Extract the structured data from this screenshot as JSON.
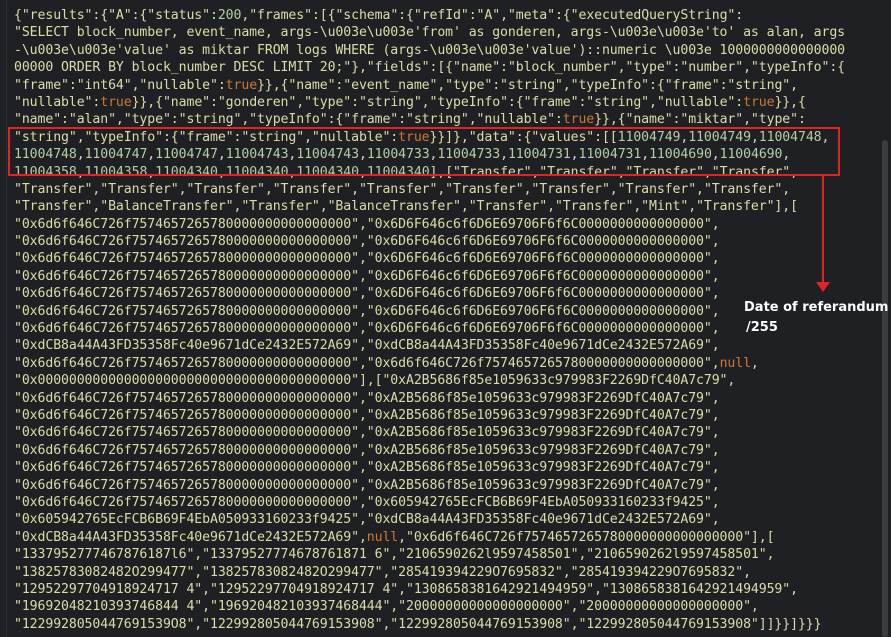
{
  "lines": [
    [
      [
        "{\"results\":{\"A\":{\"status\":",
        "s"
      ],
      [
        "200",
        "n"
      ],
      [
        ",\"frames\":[{\"schema\":{\"refId\":\"A\",\"meta\":{\"executedQueryString\":",
        "s"
      ]
    ],
    [
      [
        "\"SELECT block_number, event_name, args-\\u003e\\u003e'from' as gonderen, args-\\u003e\\u003e'to' as alan, args",
        "s"
      ]
    ],
    [
      [
        "-\\u003e\\u003e'value' as miktar FROM logs WHERE (args-\\u003e\\u003e'value')::numeric \\u003e 1000000000000000",
        "s"
      ]
    ],
    [
      [
        "00000 ORDER BY block_number DESC LIMIT 20;\"},\"fields\":[{\"name\":\"block_number\",\"type\":\"number\",\"typeInfo\":{",
        "s"
      ]
    ],
    [
      [
        "\"frame\":\"int64\",\"nullable\":",
        "s"
      ],
      [
        "true",
        "kw"
      ],
      [
        "}},{\"name\":\"event_name\",\"type\":\"string\",\"typeInfo\":{\"frame\":\"string\",",
        "s"
      ]
    ],
    [
      [
        "\"nullable\":",
        "s"
      ],
      [
        "true",
        "kw"
      ],
      [
        "}},{\"name\":\"gonderen\",\"type\":\"string\",\"typeInfo\":{\"frame\":\"string\",\"nullable\":",
        "s"
      ],
      [
        "true",
        "kw"
      ],
      [
        "}},{",
        "s"
      ]
    ],
    [
      [
        "\"name\":\"alan\",\"type\":\"string\",\"typeInfo\":{\"frame\":\"string\",\"nullable\":",
        "s"
      ],
      [
        "true",
        "kw"
      ],
      [
        "}},{\"name\":\"miktar\",\"type\":",
        "s"
      ]
    ],
    [
      [
        "\"string\",\"typeInfo\":{\"frame\":\"string\",\"nullable\":",
        "s"
      ],
      [
        "true",
        "kw"
      ],
      [
        "}}]},\"data\":{\"values\":[[",
        "s"
      ],
      [
        "11004749",
        "n"
      ],
      [
        ",",
        "p"
      ],
      [
        "11004749",
        "n"
      ],
      [
        ",",
        "p"
      ],
      [
        "11004748",
        "n"
      ],
      [
        ",",
        "p"
      ]
    ],
    [
      [
        "11004748",
        "n"
      ],
      [
        ",",
        "p"
      ],
      [
        "11004747",
        "n"
      ],
      [
        ",",
        "p"
      ],
      [
        "11004747",
        "n"
      ],
      [
        ",",
        "p"
      ],
      [
        "11004743",
        "n"
      ],
      [
        ",",
        "p"
      ],
      [
        "11004743",
        "n"
      ],
      [
        ",",
        "p"
      ],
      [
        "11004733",
        "n"
      ],
      [
        ",",
        "p"
      ],
      [
        "11004733",
        "n"
      ],
      [
        ",",
        "p"
      ],
      [
        "11004731",
        "n"
      ],
      [
        ",",
        "p"
      ],
      [
        "11004731",
        "n"
      ],
      [
        ",",
        "p"
      ],
      [
        "11004690",
        "n"
      ],
      [
        ",",
        "p"
      ],
      [
        "11004690",
        "n"
      ],
      [
        ",",
        "p"
      ]
    ],
    [
      [
        "11004358",
        "n"
      ],
      [
        ",",
        "p"
      ],
      [
        "11004358",
        "n"
      ],
      [
        ",",
        "p"
      ],
      [
        "11004340",
        "n"
      ],
      [
        ",",
        "p"
      ],
      [
        "11004340",
        "n"
      ],
      [
        ",",
        "p"
      ],
      [
        "11004340",
        "n"
      ],
      [
        ",",
        "p"
      ],
      [
        "11004340",
        "n"
      ],
      [
        "],[\"Transfer\",\"Transfer\",\"Transfer\",\"Transfer\",",
        "s"
      ]
    ],
    [
      [
        "\"Transfer\",\"Transfer\",\"Transfer\",\"Transfer\",\"Transfer\",\"Transfer\",\"Transfer\",\"Transfer\",\"Transfer\",",
        "s"
      ]
    ],
    [
      [
        "\"Transfer\",\"BalanceTransfer\",\"Transfer\",\"BalanceTransfer\",\"Transfer\",\"Transfer\",\"Mint\",\"Transfer\"],[",
        "s"
      ]
    ],
    [
      [
        "\"0x6d6f646C726f7574657265780000000000000000\",\"0x6D6F646c6f6D6E69706F6f6C0000000000000000\",",
        "s"
      ]
    ],
    [
      [
        "\"0x6d6f646C726f7574657265780000000000000000\",\"0x6D6F646c6f6D6E69706F6f6C0000000000000000\",",
        "s"
      ]
    ],
    [
      [
        "\"0x6d6f646C726f7574657265780000000000000000\",\"0x6D6F646c6f6D6E69706F6f6C0000000000000000\",",
        "s"
      ]
    ],
    [
      [
        "\"0x6d6f646C726f7574657265780000000000000000\",\"0x6D6F646c6f6D6E69706F6f6C0000000000000000\",",
        "s"
      ]
    ],
    [
      [
        "\"0x6d6f646C726f7574657265780000000000000000\",\"0x6D6F646c6f6D6E69706F6f6C0000000000000000\",",
        "s"
      ]
    ],
    [
      [
        "\"0x6d6f646C726f7574657265780000000000000000\",\"0x6D6F646c6f6D6E69706F6f6C0000000000000000\",",
        "s"
      ]
    ],
    [
      [
        "\"0x6d6f646C726f7574657265780000000000000000\",\"0x6D6F646c6f6D6E69706F6f6C0000000000000000\",",
        "s"
      ]
    ],
    [
      [
        "\"0xdCB8a44A43FD35358Fc40e9671dCe2432E572A69\",\"0xdCB8a44A43FD35358Fc40e9671dCe2432E572A69\",",
        "s"
      ]
    ],
    [
      [
        "\"0x6d6f646C726f7574657265780000000000000000\",\"0x6d6f646C726f7574657265780000000000000000\",",
        "s"
      ],
      [
        "null",
        "kw"
      ],
      [
        ",",
        "p"
      ]
    ],
    [
      [
        "\"0x0000000000000000000000000000000000000000\"],[\"0xA2B5686f85e1059633c979983F2269DfC40A7c79\",",
        "s"
      ]
    ],
    [
      [
        "\"0x6d6f646C726f7574657265780000000000000000\",\"0xA2B5686f85e1059633c979983F2269DfC40A7c79\",",
        "s"
      ]
    ],
    [
      [
        "\"0x6d6f646C726f7574657265780000000000000000\",\"0xA2B5686f85e1059633c979983F2269DfC40A7c79\",",
        "s"
      ]
    ],
    [
      [
        "\"0x6d6f646C726f7574657265780000000000000000\",\"0xA2B5686f85e1059633c979983F2269DfC40A7c79\",",
        "s"
      ]
    ],
    [
      [
        "\"0x6d6f646C726f7574657265780000000000000000\",\"0xA2B5686f85e1059633c979983F2269DfC40A7c79\",",
        "s"
      ]
    ],
    [
      [
        "\"0x6d6f646C726f7574657265780000000000000000\",\"0xA2B5686f85e1059633c979983F2269DfC40A7c79\",",
        "s"
      ]
    ],
    [
      [
        "\"0x6d6f646C726f7574657265780000000000000000\",\"0xA2B5686f85e1059633c979983F2269DfC40A7c79\",",
        "s"
      ]
    ],
    [
      [
        "\"0x6d6f646C726f7574657265780000000000000000\",\"0x605942765EcFCB6B69F4EbA050933160233f9425\",",
        "s"
      ]
    ],
    [
      [
        "\"0x605942765EcFCB6B69F4EbA050933160233f9425\",\"0xdCB8a44A43FD35358Fc40e9671dCe2432E572A69\",",
        "s"
      ]
    ],
    [
      [
        "\"0xdCB8a44A43FD35358Fc40e9671dCe2432E572A69\",",
        "s"
      ],
      [
        "null",
        "kw"
      ],
      [
        ",\"0x6d6f646C726f7574657265780000000000000000\"],[",
        "s"
      ]
    ],
    [
      [
        "\"1337952777467876187l6\",\"13379527774678761871 6\",\"2106590262l9597458501\",\"2106590262l9597458501\",",
        "s"
      ]
    ],
    [
      [
        "\"13825783082482O299477\",\"13825783082482O299477\",\"285419394229O7695832\",\"285419394229O7695832\",",
        "s"
      ]
    ],
    [
      [
        "\"12952297704918924717 4\",\"12952297704918924717 4\",\"1308658381642921494959\",\"1308658381642921494959\",",
        "s"
      ]
    ],
    [
      [
        "\"19692048210393746844 4\",\"196920482103937468444\",\"20000000000000000000\",\"20000000000000000000\",",
        "s"
      ]
    ],
    [
      [
        "\"1229928050447691539O8\",\"122992805044769153908\",\"122992805044769153908\",\"122992805044769153908\"]]}}]}}}",
        "s"
      ]
    ]
  ],
  "annotation": {
    "line1": "Date of referandum",
    "line2": "/255"
  },
  "colors": {
    "background": "#1f2023",
    "code_text": "#dcdcaa",
    "numbers": "#b5cea8",
    "keywords": "#cc7832",
    "highlight": "#e02424"
  }
}
